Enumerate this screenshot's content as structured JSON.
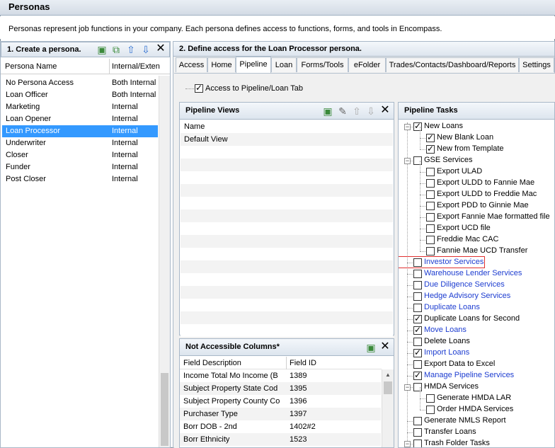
{
  "window": {
    "title": "Personas"
  },
  "description": "Personas represent job functions in your company. Each persona defines access to functions, forms, and tools in Encompass.",
  "left_panel": {
    "header": "1. Create a persona.",
    "columns": [
      "Persona Name",
      "Internal/Exten"
    ],
    "rows": [
      {
        "name": "No Persona Access",
        "type": "Both Internal a"
      },
      {
        "name": "Loan Officer",
        "type": "Both Internal a"
      },
      {
        "name": "Marketing",
        "type": "Internal"
      },
      {
        "name": "Loan Opener",
        "type": "Internal"
      },
      {
        "name": "Loan Processor",
        "type": "Internal"
      },
      {
        "name": "Underwriter",
        "type": "Internal"
      },
      {
        "name": "Closer",
        "type": "Internal"
      },
      {
        "name": "Funder",
        "type": "Internal"
      },
      {
        "name": "Post Closer",
        "type": "Internal"
      }
    ],
    "selected_index": 4
  },
  "right_panel": {
    "header": "2. Define access for the Loan Processor persona.",
    "tabs": [
      "Access",
      "Home",
      "Pipeline",
      "Loan",
      "Forms/Tools",
      "eFolder",
      "Trades/Contacts/Dashboard/Reports",
      "Settings"
    ],
    "active_tab": "Pipeline",
    "access_checkbox_label": "Access to Pipeline/Loan Tab",
    "pipeline_views": {
      "header": "Pipeline Views",
      "rows": [
        "Name",
        "Default View"
      ]
    },
    "not_accessible": {
      "header": "Not Accessible Columns*",
      "columns": [
        "Field Description",
        "Field ID"
      ],
      "rows": [
        {
          "desc": "Income Total Mo Income (B",
          "id": "1389"
        },
        {
          "desc": "Subject Property State Cod",
          "id": "1395"
        },
        {
          "desc": "Subject Property County Co",
          "id": "1396"
        },
        {
          "desc": "Purchaser Type",
          "id": "1397"
        },
        {
          "desc": "Borr DOB - 2nd",
          "id": "1402#2"
        },
        {
          "desc": "Borr Ethnicity",
          "id": "1523"
        }
      ]
    },
    "pipeline_tasks": {
      "header": "Pipeline Tasks",
      "items": [
        {
          "label": "New Loans",
          "level": 0,
          "checked": true,
          "expand": "-",
          "link": false
        },
        {
          "label": "New Blank Loan",
          "level": 1,
          "checked": true,
          "link": false
        },
        {
          "label": "New from Template",
          "level": 1,
          "checked": true,
          "link": false
        },
        {
          "label": "GSE Services",
          "level": 0,
          "checked": false,
          "expand": "-",
          "link": false
        },
        {
          "label": "Export ULAD",
          "level": 1,
          "checked": false,
          "link": false
        },
        {
          "label": "Export ULDD to Fannie Mae",
          "level": 1,
          "checked": false,
          "link": false
        },
        {
          "label": "Export ULDD to Freddie Mac",
          "level": 1,
          "checked": false,
          "link": false
        },
        {
          "label": "Export PDD to Ginnie Mae",
          "level": 1,
          "checked": false,
          "link": false
        },
        {
          "label": "Export Fannie Mae formatted file",
          "level": 1,
          "checked": false,
          "link": false
        },
        {
          "label": "Export UCD file",
          "level": 1,
          "checked": false,
          "link": false
        },
        {
          "label": "Freddie Mac CAC",
          "level": 1,
          "checked": false,
          "link": false
        },
        {
          "label": "Fannie Mae UCD Transfer",
          "level": 1,
          "checked": false,
          "link": false
        },
        {
          "label": "Investor Services",
          "level": 0,
          "checked": false,
          "link": true,
          "highlight": true
        },
        {
          "label": "Warehouse Lender Services",
          "level": 0,
          "checked": false,
          "link": true
        },
        {
          "label": "Due Diligence Services",
          "level": 0,
          "checked": false,
          "link": true
        },
        {
          "label": "Hedge Advisory Services",
          "level": 0,
          "checked": false,
          "link": true
        },
        {
          "label": "Duplicate Loans",
          "level": 0,
          "checked": false,
          "link": true
        },
        {
          "label": "Duplicate Loans for Second",
          "level": 0,
          "checked": true,
          "link": false
        },
        {
          "label": "Move Loans",
          "level": 0,
          "checked": true,
          "link": true
        },
        {
          "label": "Delete Loans",
          "level": 0,
          "checked": false,
          "link": false
        },
        {
          "label": "Import Loans",
          "level": 0,
          "checked": true,
          "link": true
        },
        {
          "label": "Export Data to Excel",
          "level": 0,
          "checked": false,
          "link": false
        },
        {
          "label": "Manage Pipeline Services",
          "level": 0,
          "checked": true,
          "link": true
        },
        {
          "label": "HMDA Services",
          "level": 0,
          "checked": false,
          "expand": "-",
          "link": false
        },
        {
          "label": "Generate HMDA LAR",
          "level": 1,
          "checked": false,
          "link": false
        },
        {
          "label": "Order HMDA Services",
          "level": 1,
          "checked": false,
          "link": false
        },
        {
          "label": "Generate NMLS Report",
          "level": 0,
          "checked": false,
          "link": false
        },
        {
          "label": "Transfer Loans",
          "level": 0,
          "checked": false,
          "link": false
        },
        {
          "label": "Trash Folder Tasks",
          "level": 0,
          "checked": false,
          "expand": "-",
          "link": false
        }
      ]
    }
  },
  "colors": {
    "link": "#1c3cd0",
    "selection": "#3399ff",
    "highlight_box": "#e03030"
  }
}
